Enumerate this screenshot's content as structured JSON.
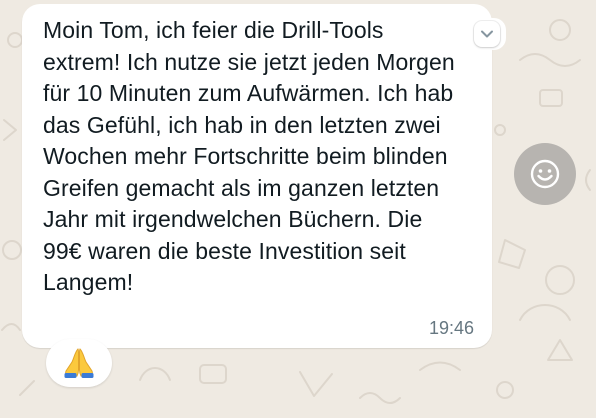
{
  "message": {
    "text": "Moin Tom, ich feier die Drill-Tools extrem! Ich nutze sie jetzt jeden Morgen für 10 Minuten zum Aufwärmen. Ich hab das Gefühl, ich hab in den letzten zwei Wochen mehr Fortschritte beim blinden Greifen gemacht als im ganzen letzten Jahr mit irgendwelchen Büchern. Die 99€ waren die beste Investition seit Langem!",
    "time": "19:46",
    "menu_icon": "chevron-down-icon"
  },
  "reaction_button": {
    "icon": "smiley-icon"
  },
  "reaction": {
    "emoji": "🙏"
  },
  "colors": {
    "background": "#efeae2",
    "bubble": "#ffffff",
    "text": "#111b21",
    "timestamp": "#667781",
    "react_button": "#b7b4b0"
  }
}
